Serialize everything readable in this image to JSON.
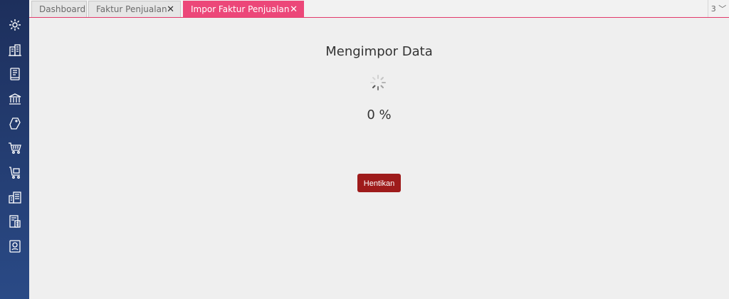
{
  "sidebar": {
    "items": [
      {
        "icon": "gear-icon"
      },
      {
        "icon": "building-icon"
      },
      {
        "icon": "book-icon"
      },
      {
        "icon": "bank-icon"
      },
      {
        "icon": "price-tag-icon"
      },
      {
        "icon": "shopping-cart-icon"
      },
      {
        "icon": "cart-box-icon"
      },
      {
        "icon": "report-building-icon"
      },
      {
        "icon": "tax-document-icon"
      },
      {
        "icon": "id-card-icon"
      }
    ]
  },
  "tabs": [
    {
      "label": "Dashboard",
      "closable": false,
      "active": false
    },
    {
      "label": "Faktur Penjualan",
      "closable": true,
      "active": false
    },
    {
      "label": "Impor Faktur Penjualan",
      "closable": true,
      "active": true
    }
  ],
  "tab_close_symbol": "✕",
  "tab_count": "3 ﹀",
  "main": {
    "heading": "Mengimpor Data",
    "percent": "0 %",
    "stop_label": "Hentikan"
  },
  "colors": {
    "active_tab": "#ec4779",
    "stop_button": "#9e1b1b",
    "sidebar": "#23396d"
  }
}
